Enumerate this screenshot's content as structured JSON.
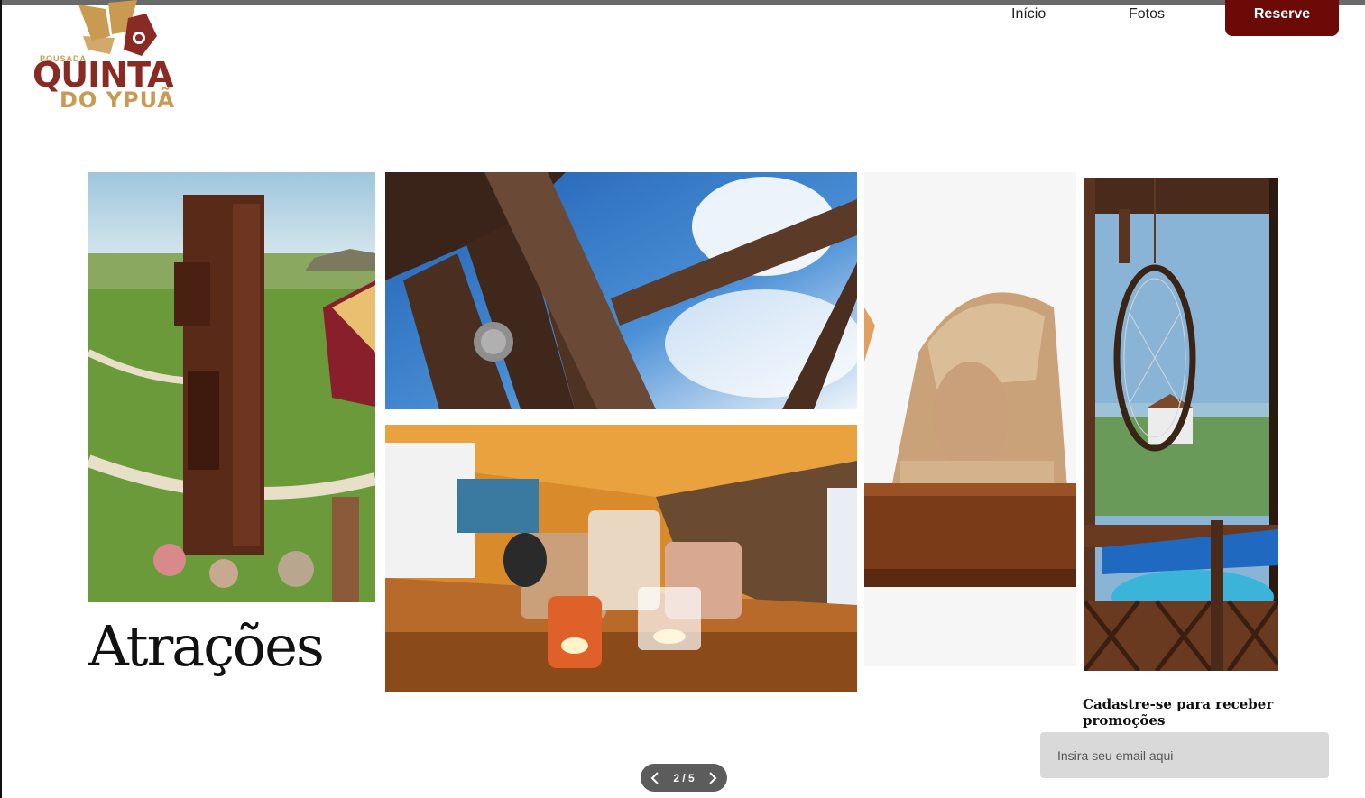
{
  "brand": {
    "logo_small": "POUSADA",
    "logo_main": "QUINTA",
    "logo_sub": "DO YPUÃ",
    "colors": {
      "maroon": "#8a2a25",
      "gold": "#c99a52",
      "button": "#6b0a06"
    }
  },
  "nav": {
    "items": [
      {
        "label": "Início"
      },
      {
        "label": "Fotos"
      }
    ],
    "cta_label": "Reserve"
  },
  "gallery": {
    "title": "Atrações",
    "current": 2,
    "total": 5,
    "counter": "2 / 5",
    "prev_icon": "chevron-left-icon",
    "next_icon": "chevron-right-icon"
  },
  "newsletter": {
    "label": "Cadastre-se para receber promoções",
    "placeholder": "Insira seu email aqui"
  }
}
